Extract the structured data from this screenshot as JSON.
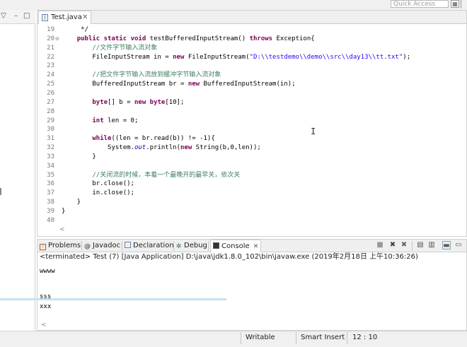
{
  "quick_access": {
    "placeholder": "Quick Access"
  },
  "left_panel": {
    "menu_glyph": "▽",
    "minimize_glyph": "–",
    "maximize_glyph": "□"
  },
  "editor": {
    "tab": {
      "label": "Test.java",
      "close": "✕"
    },
    "lines": [
      {
        "num": "19",
        "text": "     */"
      },
      {
        "num": "20",
        "fold": "⊖",
        "text": "    public static void testBufferedInputStream() throws Exception{"
      },
      {
        "num": "21",
        "text": "        //文件字节输入流对象"
      },
      {
        "num": "22",
        "text": "        FileInputStream in = new FileInputStream(\"D:\\\\testdemo\\\\demo\\\\src\\\\day13\\\\tt.txt\");"
      },
      {
        "num": "23",
        "text": ""
      },
      {
        "num": "24",
        "text": "        //把文件字节输入流放到缓冲字节输入流对象"
      },
      {
        "num": "25",
        "text": "        BufferedInputStream br = new BufferedInputStream(in);"
      },
      {
        "num": "26",
        "text": ""
      },
      {
        "num": "27",
        "text": "        byte[] b = new byte[10];"
      },
      {
        "num": "28",
        "text": ""
      },
      {
        "num": "29",
        "text": "        int len = 0;"
      },
      {
        "num": "30",
        "text": ""
      },
      {
        "num": "31",
        "text": "        while((len = br.read(b)) != -1){"
      },
      {
        "num": "32",
        "text": "            System.out.println(new String(b,0,len));"
      },
      {
        "num": "33",
        "text": "        }"
      },
      {
        "num": "34",
        "text": ""
      },
      {
        "num": "35",
        "text": "        //关闭流的时候，本着一个最晚开的最早关，依次关"
      },
      {
        "num": "36",
        "text": "        br.close();"
      },
      {
        "num": "37",
        "text": "        in.close();"
      },
      {
        "num": "38",
        "text": "    }"
      },
      {
        "num": "39",
        "text": "}"
      },
      {
        "num": "40",
        "text": ""
      }
    ]
  },
  "console": {
    "tabs": [
      {
        "icon": "problems-icon",
        "label": "Problems"
      },
      {
        "icon": "javadoc-icon",
        "label": "Javadoc"
      },
      {
        "icon": "declaration-icon",
        "label": "Declaration"
      },
      {
        "icon": "debug-icon",
        "label": "Debug"
      },
      {
        "icon": "console-icon",
        "label": "Console",
        "close": "✕",
        "selected": true
      }
    ],
    "terminated_line": "<terminated> Test (7) [Java Application] D:\\java\\jdk1.8.0_102\\bin\\javaw.exe (2019年2月18日 上午10:36:26)",
    "output": [
      "wwww",
      "",
      "",
      "sss",
      "xxx"
    ]
  },
  "status_bar": {
    "writable": "Writable",
    "insert_mode": "Smart Insert",
    "position": "12 : 10"
  },
  "colors": {
    "keyword": "#7f0055",
    "comment": "#3f7f5f",
    "string": "#2a00ff",
    "field": "#0000c0"
  }
}
